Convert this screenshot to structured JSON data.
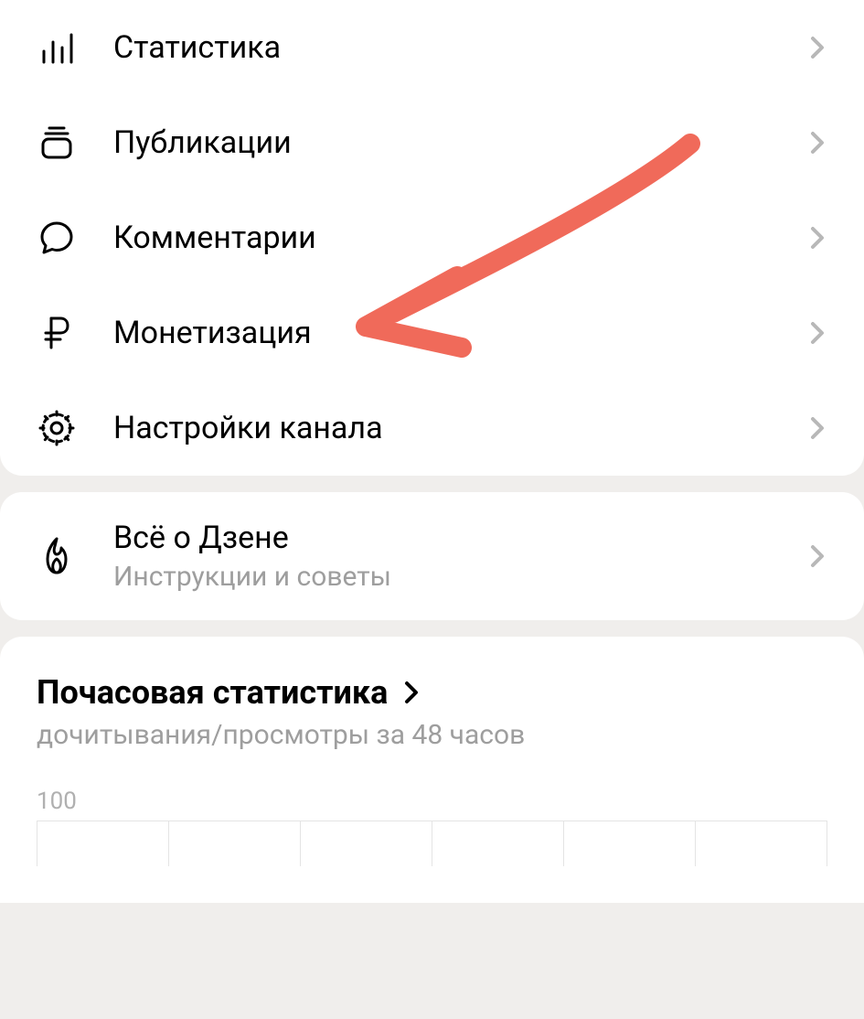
{
  "menu": {
    "statistics": "Статистика",
    "publications": "Публикации",
    "comments": "Комментарии",
    "monetization": "Монетизация",
    "channel_settings": "Настройки канала"
  },
  "about": {
    "title": "Всё о Дзене",
    "subtitle": "Инструкции и советы"
  },
  "hourly": {
    "title": "Почасовая статистика",
    "subtitle": "дочитывания/просмотры за 48 часов"
  },
  "chart_data": {
    "type": "bar",
    "categories": [],
    "values": [],
    "title": "",
    "xlabel": "",
    "ylabel": "",
    "ylim": [
      0,
      100
    ],
    "y_tick_visible": 100
  },
  "annotation": {
    "arrow_color": "#f06a5a"
  }
}
